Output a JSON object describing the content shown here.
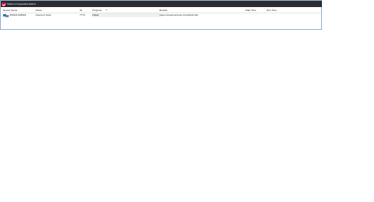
{
  "window": {
    "title": "Status of requested actions"
  },
  "table": {
    "columns": {
      "device_name": "Device Name",
      "action": "Action",
      "id": "ID",
      "progress": "Progress",
      "results": "Results",
      "start_time": "Start Time",
      "run_time": "Run Time"
    },
    "rows": [
      {
        "device_name": "WIN10LSF8901",
        "action": "Inventory Scan",
        "id": "7774",
        "progress": "Failed",
        "results": "Agent refused access (unauthorized)",
        "start_time": "",
        "run_time": ""
      }
    ]
  },
  "icons": {
    "app": "app-logo-icon",
    "device": "computer-icon",
    "sort": "sort-down-icon"
  },
  "colors": {
    "titlebar": "#2d2d30",
    "accent": "#c8102e",
    "border": "#8fb3d9"
  }
}
